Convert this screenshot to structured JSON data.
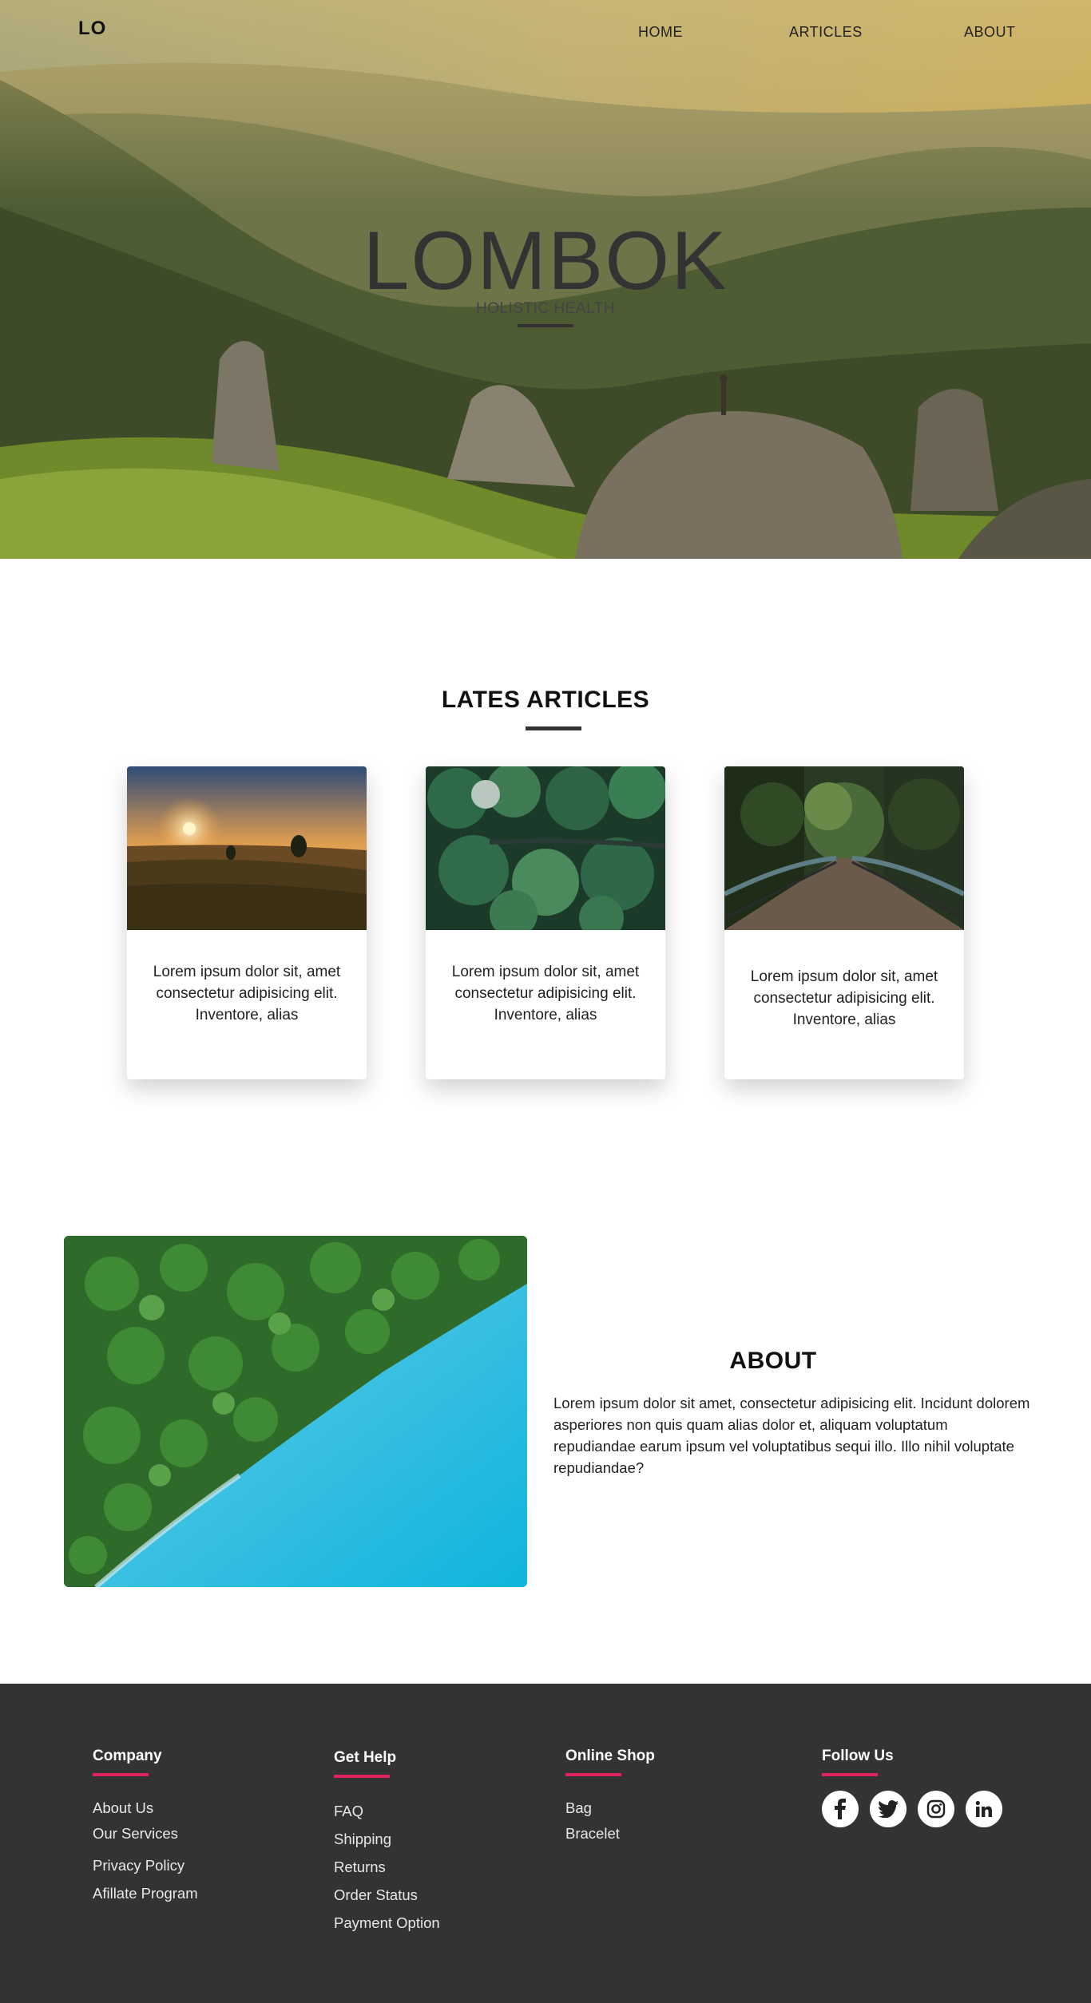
{
  "header": {
    "logo": "LO",
    "nav": [
      {
        "label": "HOME"
      },
      {
        "label": "ARTICLES"
      },
      {
        "label": "ABOUT"
      }
    ]
  },
  "hero": {
    "title": "LOMBOK",
    "subtitle": "HOLISTIC HEALTH"
  },
  "articles": {
    "title": "LATES ARTICLES",
    "cards": [
      {
        "text": "Lorem ipsum dolor sit, amet consectetur adipisicing elit. Inventore, alias"
      },
      {
        "text": "Lorem ipsum dolor sit, amet consectetur adipisicing elit. Inventore, alias"
      },
      {
        "text": "Lorem ipsum dolor sit, amet consectetur adipisicing elit. Inventore, alias"
      }
    ]
  },
  "about": {
    "title": "ABOUT",
    "text": "Lorem ipsum dolor sit amet, consectetur adipisicing elit. Incidunt dolorem asperiores non quis quam alias dolor et, aliquam voluptatum repudiandae earum ipsum vel voluptatibus sequi illo. Illo nihil voluptate repudiandae?"
  },
  "footer": {
    "company": {
      "title": "Company",
      "links": [
        "About Us",
        "Our Services",
        "Privacy Policy",
        "Afillate Program"
      ]
    },
    "help": {
      "title": "Get Help",
      "links": [
        "FAQ",
        "Shipping",
        "Returns",
        "Order Status",
        "Payment Option"
      ]
    },
    "shop": {
      "title": "Online Shop",
      "links": [
        "Bag",
        "Bracelet"
      ]
    },
    "follow": {
      "title": "Follow Us",
      "icons": [
        "facebook-icon",
        "twitter-icon",
        "instagram-icon",
        "linkedin-icon"
      ]
    },
    "accent_color": "#e0245e",
    "background": "#333333"
  }
}
